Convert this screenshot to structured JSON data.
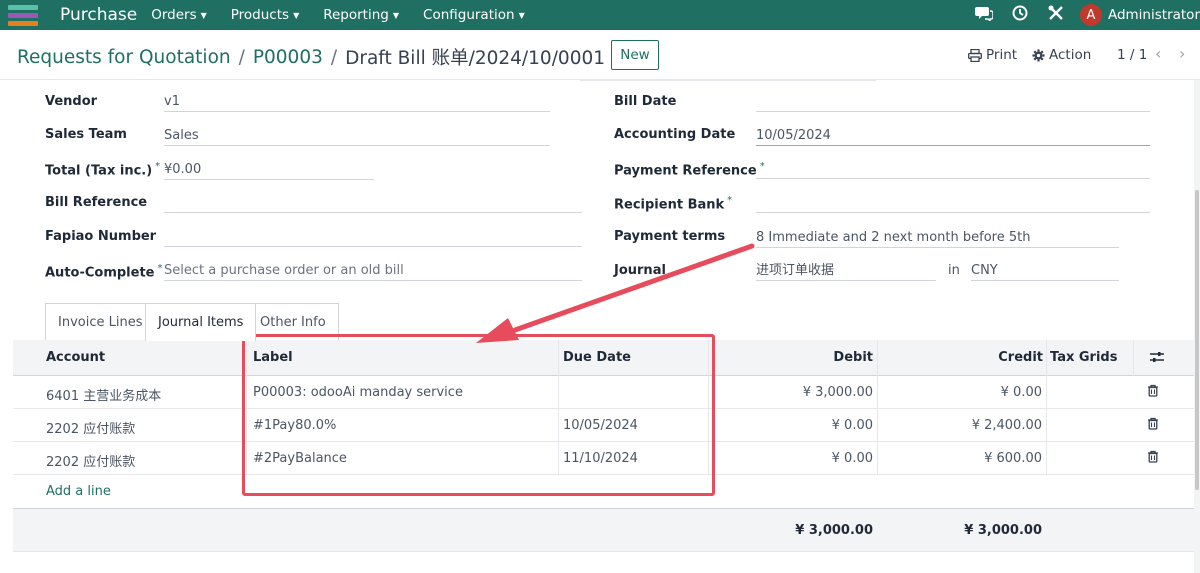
{
  "navbar": {
    "app_name": "Purchase",
    "menus": [
      "Orders",
      "Products",
      "Reporting",
      "Configuration"
    ],
    "user_initial": "A",
    "user_name": "Administrator",
    "brand_color": "#1f6f62",
    "avatar_color": "#c0392b"
  },
  "breadcrumb": {
    "items": [
      "Requests for Quotation",
      "P00003"
    ],
    "separator": "/",
    "current": "Draft Bill 账单/2024/10/0001"
  },
  "control": {
    "new_label": "New",
    "print_label": "Print",
    "action_label": "Action",
    "pager": "1 / 1"
  },
  "form": {
    "left": [
      {
        "label": "Vendor",
        "value": "v1",
        "required": false
      },
      {
        "label": "Sales Team",
        "value": "Sales",
        "required": false
      },
      {
        "label": "Total (Tax inc.)",
        "value": "¥0.00",
        "required": true
      },
      {
        "label": "Bill Reference",
        "value": "",
        "required": false
      },
      {
        "label": "Fapiao Number",
        "value": "",
        "required": false
      },
      {
        "label": "Auto-Complete",
        "value": "Select a purchase order or an old bill",
        "required": true
      }
    ],
    "right": [
      {
        "label": "Bill Date",
        "value": "",
        "required": false
      },
      {
        "label": "Accounting Date",
        "value": "10/05/2024",
        "required": false
      },
      {
        "label": "Payment Reference",
        "value": "",
        "required": true
      },
      {
        "label": "Recipient Bank",
        "value": "",
        "required": true
      },
      {
        "label": "Payment terms",
        "value": "8 Immediate and 2 next month before 5th",
        "required": false
      },
      {
        "label": "Journal",
        "value": "进项订单收据",
        "required": false
      }
    ],
    "journal_in": "in",
    "currency": "CNY",
    "required_mark": "*"
  },
  "tabs": [
    "Invoice Lines",
    "Journal Items",
    "Other Info"
  ],
  "active_tab": "Journal Items",
  "table": {
    "headers": {
      "account": "Account",
      "label": "Label",
      "due_date": "Due Date",
      "debit": "Debit",
      "credit": "Credit",
      "tax_grids": "Tax Grids"
    },
    "rows": [
      {
        "account": "6401 主营业务成本",
        "label": "P00003: odooAi manday service",
        "due_date": "",
        "debit": "¥ 3,000.00",
        "credit": "¥ 0.00"
      },
      {
        "account": "2202 应付账款",
        "label": "#1Pay80.0%",
        "due_date": "10/05/2024",
        "debit": "¥ 0.00",
        "credit": "¥ 2,400.00"
      },
      {
        "account": "2202 应付账款",
        "label": "#2PayBalance",
        "due_date": "11/10/2024",
        "debit": "¥ 0.00",
        "credit": "¥ 600.00"
      }
    ],
    "add_line": "Add a line",
    "total_debit": "¥ 3,000.00",
    "total_credit": "¥ 3,000.00"
  },
  "annotation_color": "#e74c5c"
}
